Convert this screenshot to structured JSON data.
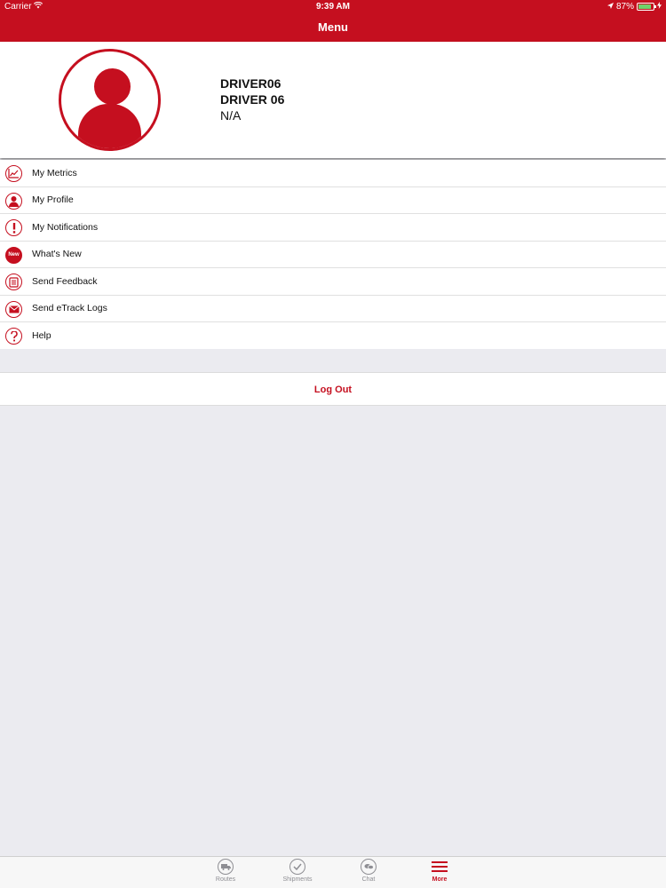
{
  "status_bar": {
    "carrier": "Carrier",
    "time": "9:39 AM",
    "battery": "87%",
    "battery_level": 0.87
  },
  "nav": {
    "title": "Menu"
  },
  "profile": {
    "username": "DRIVER06",
    "display_name": "DRIVER 06",
    "detail": "N/A"
  },
  "menu": {
    "items": [
      {
        "label": "My Metrics",
        "icon": "chart-icon"
      },
      {
        "label": "My Profile",
        "icon": "person-icon"
      },
      {
        "label": "My Notifications",
        "icon": "exclamation-icon"
      },
      {
        "label": "What's New",
        "icon": "new-badge-icon",
        "icon_text": "New"
      },
      {
        "label": "Send Feedback",
        "icon": "feedback-icon"
      },
      {
        "label": "Send eTrack Logs",
        "icon": "mail-icon"
      },
      {
        "label": "Help",
        "icon": "question-icon"
      }
    ]
  },
  "logout": {
    "label": "Log Out"
  },
  "tabs": [
    {
      "label": "Routes",
      "icon": "truck-icon"
    },
    {
      "label": "Shipments",
      "icon": "checkmark-icon"
    },
    {
      "label": "Chat",
      "icon": "chat-bubbles-icon"
    },
    {
      "label": "More",
      "icon": "hamburger-icon",
      "active": true
    }
  ],
  "colors": {
    "brand_red": "#c50f1f",
    "background": "#ebebf0"
  }
}
